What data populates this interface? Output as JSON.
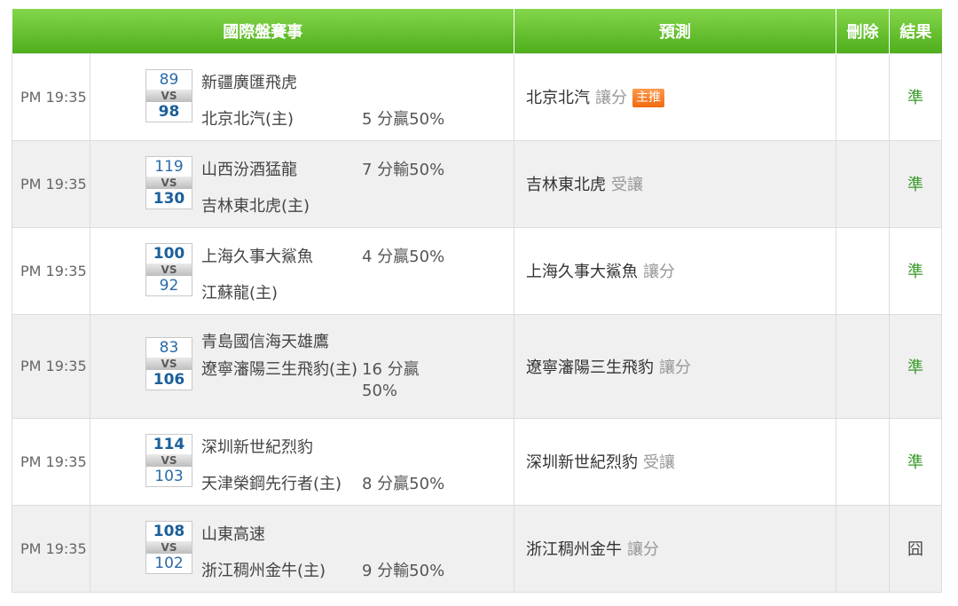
{
  "header": {
    "match": "國際盤賽事",
    "prediction": "預測",
    "delete": "刪除",
    "result": "結果"
  },
  "rows": [
    {
      "time": "PM 19:35",
      "away_score": "89",
      "home_score": "98",
      "vs": "VS",
      "away_team": "新疆廣匯飛虎",
      "home_team": "北京北汽(主)",
      "handicap": "5 分贏50%",
      "pick": "北京北汽",
      "tip": "讓分",
      "badge": "主推",
      "result": "準"
    },
    {
      "time": "PM 19:35",
      "away_score": "119",
      "home_score": "130",
      "vs": "VS",
      "away_team": "山西汾酒猛龍",
      "home_team": "吉林東北虎(主)",
      "handicap": "7 分輸50%",
      "pick": "吉林東北虎",
      "tip": "受讓",
      "result": "準"
    },
    {
      "time": "PM 19:35",
      "away_score": "100",
      "home_score": "92",
      "vs": "VS",
      "away_team": "上海久事大鯊魚",
      "home_team": "江蘇龍(主)",
      "handicap": "4 分贏50%",
      "pick": "上海久事大鯊魚",
      "tip": "讓分",
      "result": "準"
    },
    {
      "time": "PM 19:35",
      "away_score": "83",
      "home_score": "106",
      "vs": "VS",
      "away_team": "青島國信海天雄鷹",
      "home_team": "遼寧瀋陽三生飛豹(主)",
      "handicap": "16 分贏50%",
      "pick": "遼寧瀋陽三生飛豹",
      "tip": "讓分",
      "result": "準"
    },
    {
      "time": "PM 19:35",
      "away_score": "114",
      "home_score": "103",
      "vs": "VS",
      "away_team": "深圳新世紀烈豹",
      "home_team": "天津榮鋼先行者(主)",
      "handicap": "8 分贏50%",
      "pick": "深圳新世紀烈豹",
      "tip": "受讓",
      "result": "準"
    },
    {
      "time": "PM 19:35",
      "away_score": "108",
      "home_score": "102",
      "vs": "VS",
      "away_team": "山東高速",
      "home_team": "浙江稠州金牛(主)",
      "handicap": "9 分輸50%",
      "pick": "浙江稠州金牛",
      "tip": "讓分",
      "result": "囧"
    }
  ],
  "colors": {
    "header_green": "#5cbf24",
    "result_ok": "#3a9a2a",
    "badge": "#f06a10"
  }
}
